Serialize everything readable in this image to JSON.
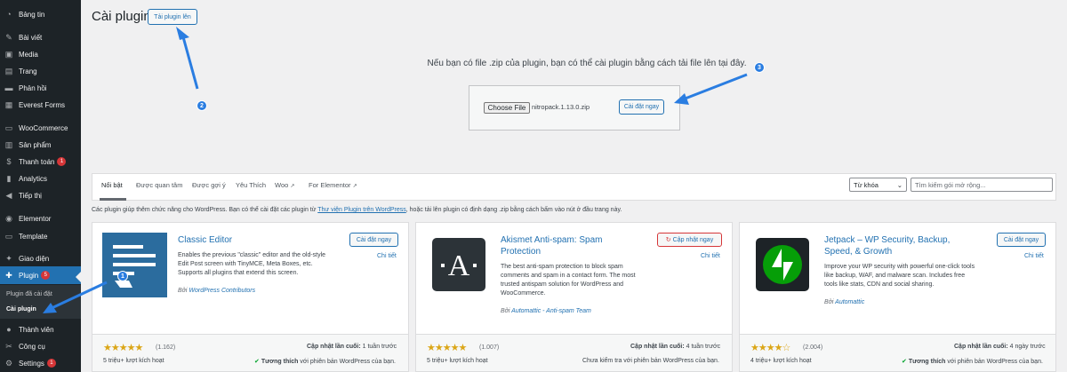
{
  "sidebar": {
    "items": [
      {
        "label": "Bảng tin",
        "icon": "dashboard-icon",
        "glyph": "◔"
      },
      {
        "label": "Bài viết",
        "icon": "pin-icon",
        "glyph": "✎"
      },
      {
        "label": "Media",
        "icon": "media-icon",
        "glyph": "▣"
      },
      {
        "label": "Trang",
        "icon": "page-icon",
        "glyph": "▤"
      },
      {
        "label": "Phản hồi",
        "icon": "comment-icon",
        "glyph": "▬"
      },
      {
        "label": "Everest Forms",
        "icon": "forms-icon",
        "glyph": "▦"
      },
      {
        "label": "WooCommerce",
        "icon": "woocommerce-icon",
        "glyph": "▭"
      },
      {
        "label": "Sản phẩm",
        "icon": "products-icon",
        "glyph": "▥"
      },
      {
        "label": "Thanh toán",
        "icon": "payment-icon",
        "glyph": "$",
        "badge": "1"
      },
      {
        "label": "Analytics",
        "icon": "analytics-icon",
        "glyph": "▮"
      },
      {
        "label": "Tiếp thị",
        "icon": "megaphone-icon",
        "glyph": "◀"
      },
      {
        "label": "Elementor",
        "icon": "elementor-icon",
        "glyph": "◉"
      },
      {
        "label": "Template",
        "icon": "folder-icon",
        "glyph": "▭"
      },
      {
        "label": "Giao diện",
        "icon": "appearance-icon",
        "glyph": "✦"
      },
      {
        "label": "Plugin",
        "icon": "plugin-icon",
        "glyph": "✚",
        "badge": "5"
      },
      {
        "label": "Thành viên",
        "icon": "users-icon",
        "glyph": "●"
      },
      {
        "label": "Công cụ",
        "icon": "tools-icon",
        "glyph": "✂"
      },
      {
        "label": "Settings",
        "icon": "settings-icon",
        "glyph": "⚙",
        "badge": "1"
      }
    ],
    "submenu": {
      "installed": "Plugin đã cài đặt",
      "add_new": "Cài plugin"
    }
  },
  "header": {
    "title": "Cài plugin",
    "upload_button": "Tải plugin lên"
  },
  "upload": {
    "message": "Nếu bạn có file .zip của plugin, bạn có thể cài plugin bằng cách tải file lên tại đây.",
    "choose_file": "Choose File",
    "file_name": "nitropack.1.13.0.zip",
    "install_button": "Cài đặt ngay"
  },
  "markers": {
    "m1": "1",
    "m2": "2",
    "m3": "3"
  },
  "filters": {
    "tabs": [
      "Nổi bật",
      "Được quan tâm",
      "Được gợi ý",
      "Yêu Thích",
      "Woo",
      "For Elementor"
    ],
    "ext_glyph": "↗",
    "search_type": "Từ khóa",
    "search_placeholder": "Tìm kiếm gói mở rộng..."
  },
  "info": {
    "before": "Các plugin giúp thêm chức năng cho WordPress. Bạn có thể cài đặt các plugin từ ",
    "link": "Thư viện Plugin trên WordPress",
    "after": ", hoặc tải lên plugin có định dạng .zip bằng cách bấm vào nút ở đầu trang này."
  },
  "cards": [
    {
      "title": "Classic Editor",
      "desc": "Enables the previous \"classic\" editor and the old-style Edit Post screen with TinyMCE, Meta Boxes, etc. Supports all plugins that extend this screen.",
      "author_prefix": "Bởi",
      "author": "WordPress Contributors",
      "button": "Cài đặt ngay",
      "details": "Chi tiết",
      "stars": "★★★★★",
      "rating_count": "(1.162)",
      "installs": "5 triệu+ lượt kích hoạt",
      "updated_label": "Cập nhật lần cuối:",
      "updated": "1 tuần trước",
      "compat_glyph": "✔",
      "compat_bold": "Tương thích",
      "compat": "với phiên bản WordPress của bạn."
    },
    {
      "title": "Akismet Anti-spam: Spam Protection",
      "desc": "The best anti-spam protection to block spam comments and spam in a contact form. The most trusted antispam solution for WordPress and WooCommerce.",
      "author_prefix": "Bởi",
      "author": "Automattic - Anti-spam Team",
      "button": "Cập nhật ngay",
      "button_glyph": "↻",
      "details": "Chi tiết",
      "stars": "★★★★★",
      "rating_count": "(1.007)",
      "installs": "5 triệu+ lượt kích hoạt",
      "updated_label": "Cập nhật lần cuối:",
      "updated": "4 tuần trước",
      "compat": "Chưa kiểm tra với phiên bản WordPress của bạn."
    },
    {
      "title": "Jetpack – WP Security, Backup, Speed, & Growth",
      "desc": "Improve your WP security with powerful one-click tools like backup, WAF, and malware scan. Includes free tools like stats, CDN and social sharing.",
      "author_prefix": "Bởi",
      "author": "Automattic",
      "button": "Cài đặt ngay",
      "details": "Chi tiết",
      "stars": "★★★★☆",
      "rating_count": "(2.004)",
      "installs": "4 triệu+ lượt kích hoạt",
      "updated_label": "Cập nhật lần cuối:",
      "updated": "4 ngày trước",
      "compat_glyph": "✔",
      "compat_bold": "Tương thích",
      "compat": "với phiên bản WordPress của bạn."
    }
  ],
  "colors": {
    "sidebar": "#1d2327",
    "accent": "#2271b1",
    "marker": "#2a7de1",
    "star": "#dba617"
  }
}
